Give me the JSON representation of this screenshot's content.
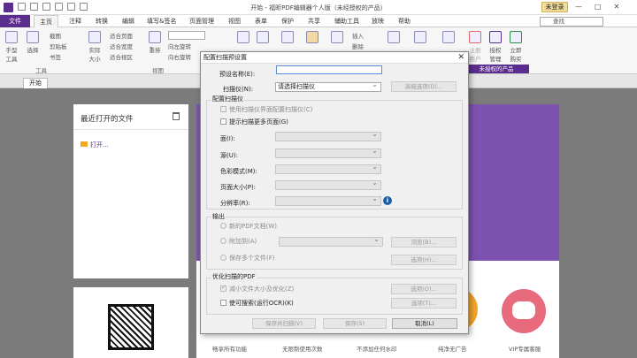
{
  "app": {
    "title": "开始 - 福昕PDF编辑器个人版（未经授权的产品）",
    "login": "未登录",
    "search_placeholder": "查找",
    "window_controls": [
      "—",
      "□",
      "✕"
    ]
  },
  "menu": {
    "file": "文件",
    "tabs": [
      "主页",
      "注释",
      "转换",
      "编辑",
      "填写&签名",
      "页面管理",
      "视图",
      "表单",
      "保护",
      "共享",
      "辅助工具",
      "放映",
      "帮助"
    ]
  },
  "ribbon": {
    "hand": "手型\n工具",
    "select": "选择",
    "snapshot": "截图",
    "clipboard": "剪贴板",
    "bookmark": "书签",
    "actual_size": "实际\n大小",
    "fit_page": "适合页面",
    "fit_width": "适合宽度",
    "fit_visible": "适合视区",
    "reflow": "重排",
    "rotate_left": "向左旋转",
    "rotate_right": "向右旋转",
    "insert": "插入",
    "delete": "删除",
    "reg_user": "注册\n用户",
    "auth_manage": "授权\n管理",
    "buy_now": "立即\n购买",
    "group_tools": "工具",
    "group_view": "视图",
    "group_unauth": "未授权的产品"
  },
  "doctab": "开始",
  "recent": {
    "title": "最近打开的文件",
    "open": "打开..."
  },
  "features": [
    "畅享所有功能",
    "无限制使用次数",
    "不添加任何水印",
    "纯净无广告",
    "VIP专属客服"
  ],
  "dialog": {
    "title": "配置扫描预设置",
    "close": "✕",
    "preset_name_label": "预设名称(E):",
    "preset_name_value": "",
    "scanner_label": "扫描仪(N):",
    "scanner_value": "请选择扫描仪",
    "advanced_btn": "高级选项(D)...",
    "config_group": "配置扫描仪",
    "use_scanner_ui": "使用扫描仪界面配置扫描仪(C)",
    "prompt_more": "提示扫描更多页面(G)",
    "side_label": "面(I):",
    "source_label": "源(U):",
    "color_label": "色彩模式(M):",
    "page_size_label": "页面大小(P):",
    "resolution_label": "分辨率(R):",
    "output_group": "输出",
    "new_pdf": "新的PDF文档(W)",
    "append_to": "附加到(A)",
    "browse_btn": "浏览(B)...",
    "save_multi": "保存多个文件(F)",
    "options_h_btn": "选项(H)...",
    "optimize_group": "优化扫描的PDF",
    "reduce_size": "减小文件大小及优化(Z)",
    "make_searchable": "使可搜索(运行OCR)(K)",
    "options_o_btn": "选项(O)...",
    "options_t_btn": "选项(T)...",
    "save_scan_btn": "保存并扫描(V)",
    "save_btn": "保存(S)",
    "cancel_btn": "取消(L)"
  }
}
